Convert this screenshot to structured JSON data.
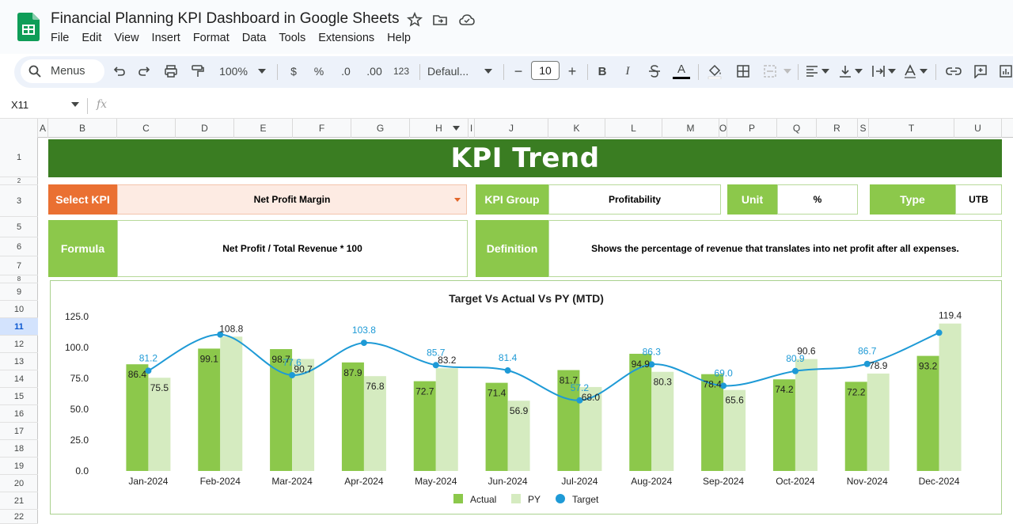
{
  "app": {
    "doc_title": "Financial Planning KPI Dashboard in Google Sheets",
    "menu": [
      "File",
      "Edit",
      "View",
      "Insert",
      "Format",
      "Data",
      "Tools",
      "Extensions",
      "Help"
    ]
  },
  "toolbar": {
    "menus_label": "Menus",
    "zoom": "100%",
    "currency": "$",
    "percent": "%",
    "dec_decrease": ".0",
    "dec_increase": ".00",
    "number_format": "123",
    "font": "Defaul...",
    "font_size": "10",
    "minus": "−",
    "plus": "+",
    "bold": "B",
    "italic": "I",
    "text_color_letter": "A"
  },
  "formula_bar": {
    "cell_ref": "X11",
    "fx": "fx"
  },
  "columns": [
    "A",
    "B",
    "C",
    "D",
    "E",
    "F",
    "G",
    "H",
    "I",
    "J",
    "K",
    "L",
    "M",
    "O",
    "P",
    "Q",
    "R",
    "S",
    "T",
    "U"
  ],
  "rows": [
    "1",
    "2",
    "3",
    "5",
    "6",
    "7",
    "8",
    "9",
    "10",
    "11",
    "12",
    "13",
    "14",
    "15",
    "16",
    "17",
    "18",
    "19",
    "20",
    "21",
    "22"
  ],
  "selected_row": "11",
  "dashboard": {
    "banner": "KPI Trend",
    "select_kpi_label": "Select KPI",
    "select_kpi_value": "Net Profit Margin",
    "kpi_group_label": "KPI Group",
    "kpi_group_value": "Profitability",
    "unit_label": "Unit",
    "unit_value": "%",
    "type_label": "Type",
    "type_value": "UTB",
    "formula_label": "Formula",
    "formula_value": "Net Profit / Total Revenue * 100",
    "definition_label": "Definition",
    "definition_value": "Shows the percentage of revenue that translates into net profit after all expenses."
  },
  "colors": {
    "actual": "#8cc84b",
    "py": "#d5ebc0",
    "target": "#1e9ad6",
    "banner": "#3a7d22",
    "label_green": "#8cc84b",
    "label_orange": "#ea7032"
  },
  "chart_data": {
    "type": "bar",
    "title": "Target Vs Actual Vs PY (MTD)",
    "categories": [
      "Jan-2024",
      "Feb-2024",
      "Mar-2024",
      "Apr-2024",
      "May-2024",
      "Jun-2024",
      "Jul-2024",
      "Aug-2024",
      "Sep-2024",
      "Oct-2024",
      "Nov-2024",
      "Dec-2024"
    ],
    "series": [
      {
        "name": "Actual",
        "kind": "bar",
        "values": [
          86.4,
          99.1,
          98.7,
          87.9,
          72.7,
          71.4,
          81.7,
          94.9,
          78.4,
          74.2,
          72.2,
          93.2
        ]
      },
      {
        "name": "PY",
        "kind": "bar",
        "values": [
          75.5,
          108.8,
          90.7,
          76.8,
          83.2,
          56.9,
          68.0,
          80.3,
          65.6,
          90.6,
          78.9,
          119.4
        ]
      },
      {
        "name": "Target",
        "kind": "line",
        "values": [
          81.2,
          110.5,
          77.6,
          103.8,
          85.7,
          81.4,
          57.2,
          86.3,
          69.0,
          80.9,
          86.7,
          112.0
        ]
      }
    ],
    "data_labels": {
      "Actual": [
        "86.4",
        "99.1",
        "98.7",
        "87.9",
        "72.7",
        "71.4",
        "81.7",
        "94.9",
        "78.4",
        "74.2",
        "72.2",
        "93.2"
      ],
      "PY": [
        "75.5",
        "108.8",
        "90.7",
        "76.8",
        "83.2",
        "56.9",
        "68.0",
        "80.3",
        "65.6",
        "90.6",
        "78.9",
        "119.4"
      ],
      "Target": [
        "81.2",
        "",
        "77.6",
        "103.8",
        "85.7",
        "81.4",
        "57.2",
        "86.3",
        "69.0",
        "80.9",
        "86.7",
        ""
      ]
    },
    "yticks": [
      "0.0",
      "25.0",
      "50.0",
      "75.0",
      "100.0",
      "125.0"
    ],
    "ylim": [
      0,
      125
    ],
    "legend": [
      "Actual",
      "PY",
      "Target"
    ],
    "legend_position": "bottom",
    "grid": false
  }
}
